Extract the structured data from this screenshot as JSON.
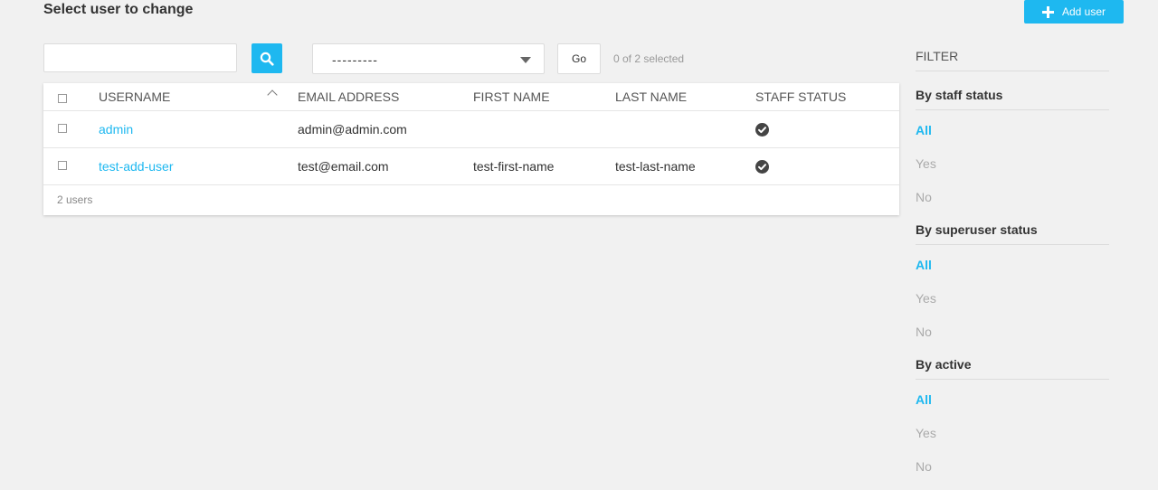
{
  "page": {
    "title": "Select user to change",
    "add_button_label": "Add user"
  },
  "colors": {
    "accent": "#1eb8f0",
    "background": "#f1f1f1",
    "muted_text": "#aaaaaa"
  },
  "toolbar": {
    "search_value": "",
    "search_icon": "search-icon",
    "action_select_value": "---------",
    "go_label": "Go",
    "selected_counter": "0 of 2 selected"
  },
  "table": {
    "columns": [
      "USERNAME",
      "EMAIL ADDRESS",
      "FIRST NAME",
      "LAST NAME",
      "STAFF STATUS"
    ],
    "rows": [
      {
        "username": "admin",
        "email": "admin@admin.com",
        "first_name": "",
        "last_name": "",
        "staff_status": "check-circle-icon"
      },
      {
        "username": "test-add-user",
        "email": "test@email.com",
        "first_name": "test-first-name",
        "last_name": "test-last-name",
        "staff_status": "check-circle-icon"
      }
    ],
    "footer": "2 users"
  },
  "filter": {
    "title": "FILTER",
    "groups": [
      {
        "heading": "By staff status",
        "options": [
          "All",
          "Yes",
          "No"
        ],
        "selected": "All"
      },
      {
        "heading": "By superuser status",
        "options": [
          "All",
          "Yes",
          "No"
        ],
        "selected": "All"
      },
      {
        "heading": "By active",
        "options": [
          "All",
          "Yes",
          "No"
        ],
        "selected": "All"
      }
    ]
  }
}
